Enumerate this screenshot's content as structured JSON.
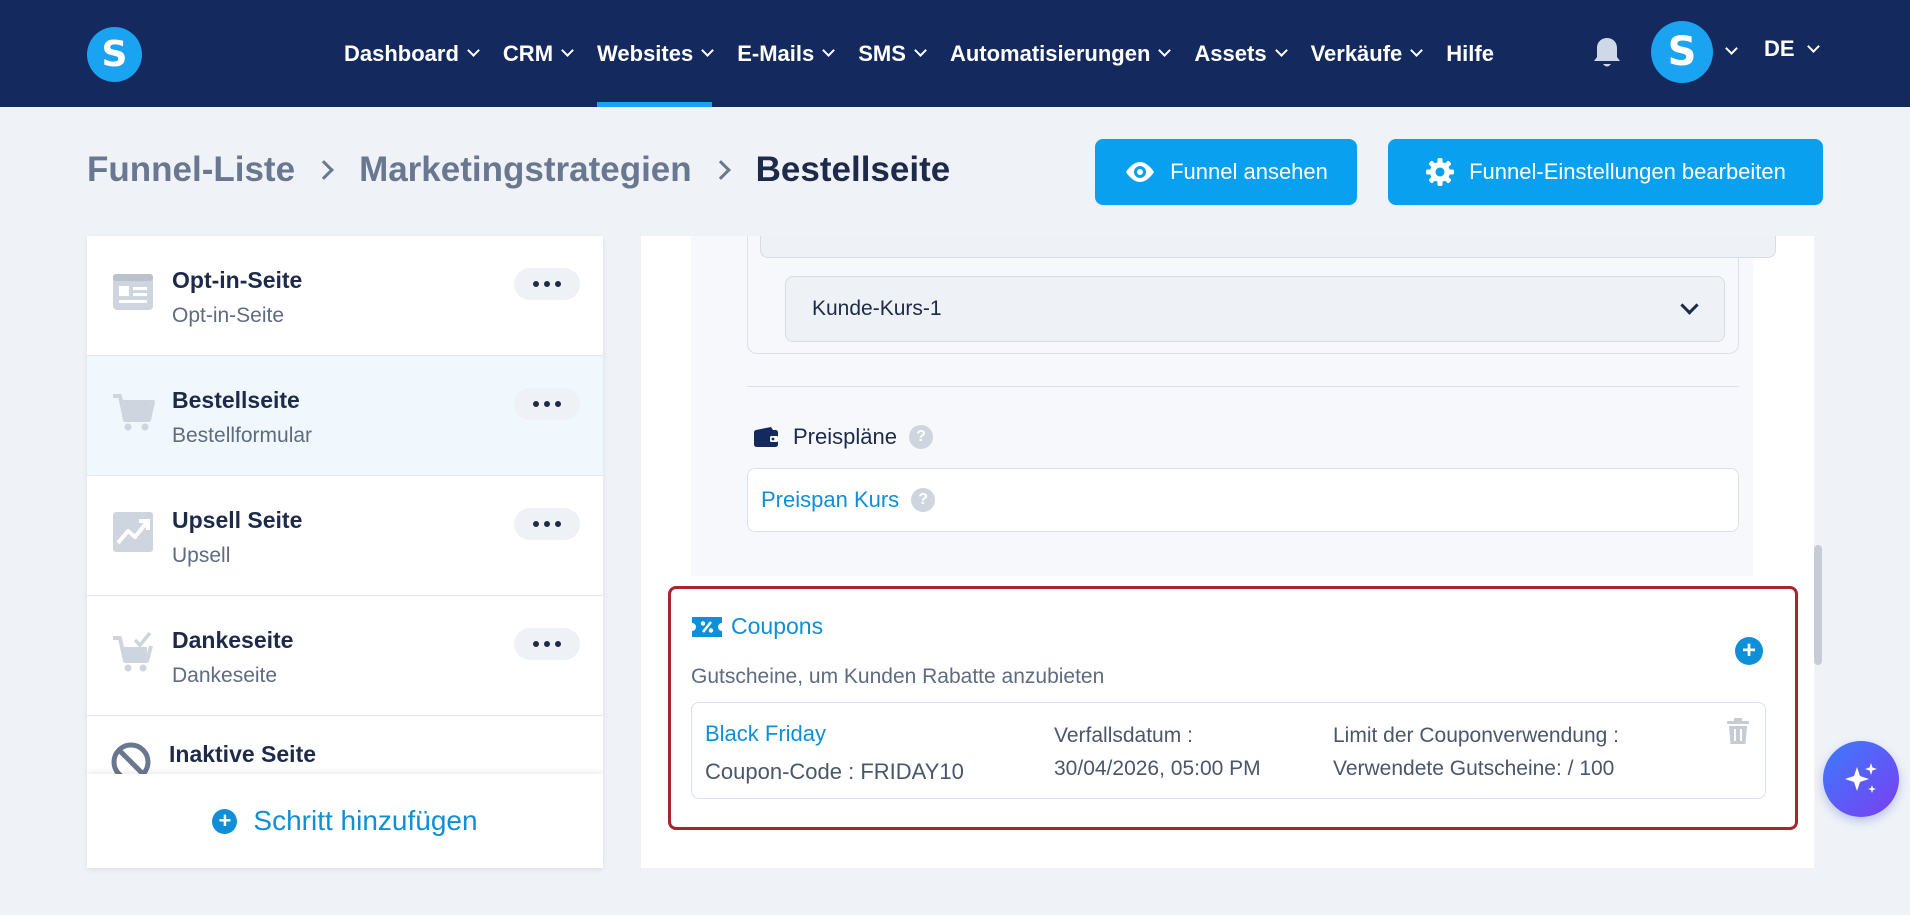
{
  "app": {
    "logo_letter": "S",
    "avatar_letter": "S",
    "language": "DE"
  },
  "nav": {
    "items": [
      {
        "label": "Dashboard",
        "arrow": true,
        "active": false
      },
      {
        "label": "CRM",
        "arrow": true,
        "active": false
      },
      {
        "label": "Websites",
        "arrow": true,
        "active": true
      },
      {
        "label": "E-Mails",
        "arrow": true,
        "active": false
      },
      {
        "label": "SMS",
        "arrow": true,
        "active": false
      },
      {
        "label": "Automatisierungen",
        "arrow": true,
        "active": false
      },
      {
        "label": "Assets",
        "arrow": true,
        "active": false
      },
      {
        "label": "Verkäufe",
        "arrow": true,
        "active": false
      },
      {
        "label": "Hilfe",
        "arrow": false,
        "active": false
      }
    ]
  },
  "breadcrumb": {
    "items": [
      "Funnel-Liste",
      "Marketingstrategien",
      "Bestellseite"
    ]
  },
  "buttons": {
    "view_funnel": "Funnel ansehen",
    "edit_settings": "Funnel-Einstellungen bearbeiten"
  },
  "steps": [
    {
      "title": "Opt-in-Seite",
      "subtitle": "Opt-in-Seite",
      "icon": "form-page-icon",
      "selected": false
    },
    {
      "title": "Bestellseite",
      "subtitle": "Bestellformular",
      "icon": "cart-icon",
      "selected": true
    },
    {
      "title": "Upsell Seite",
      "subtitle": "Upsell",
      "icon": "trending-up-icon",
      "selected": false
    },
    {
      "title": "Dankeseite",
      "subtitle": "Dankeseite",
      "icon": "cart-check-icon",
      "selected": false
    },
    {
      "title": "Inaktive Seite",
      "subtitle": "",
      "icon": "ban-icon",
      "selected": false
    }
  ],
  "add_step": {
    "label": "Schritt hinzufügen"
  },
  "product": {
    "selected_course": "Kunde-Kurs-1"
  },
  "price_plans": {
    "label": "Preispläne",
    "value": "Preispan Kurs"
  },
  "coupons": {
    "title": "Coupons",
    "description": "Gutscheine, um Kunden Rabatte anzubieten",
    "items": [
      {
        "name": "Black Friday",
        "code": "Coupon-Code : FRIDAY10",
        "expiry_label": "Verfallsdatum :",
        "expiry_value": "30/04/2026, 05:00 PM",
        "limit_label": "Limit der Couponverwendung :",
        "limit_value": "Verwendete Gutscheine: / 100"
      }
    ]
  },
  "colors": {
    "nav_bg": "#142a5e",
    "accent": "#0aa0f0",
    "link": "#0e8fd8",
    "highlight_border": "#a8252d"
  }
}
